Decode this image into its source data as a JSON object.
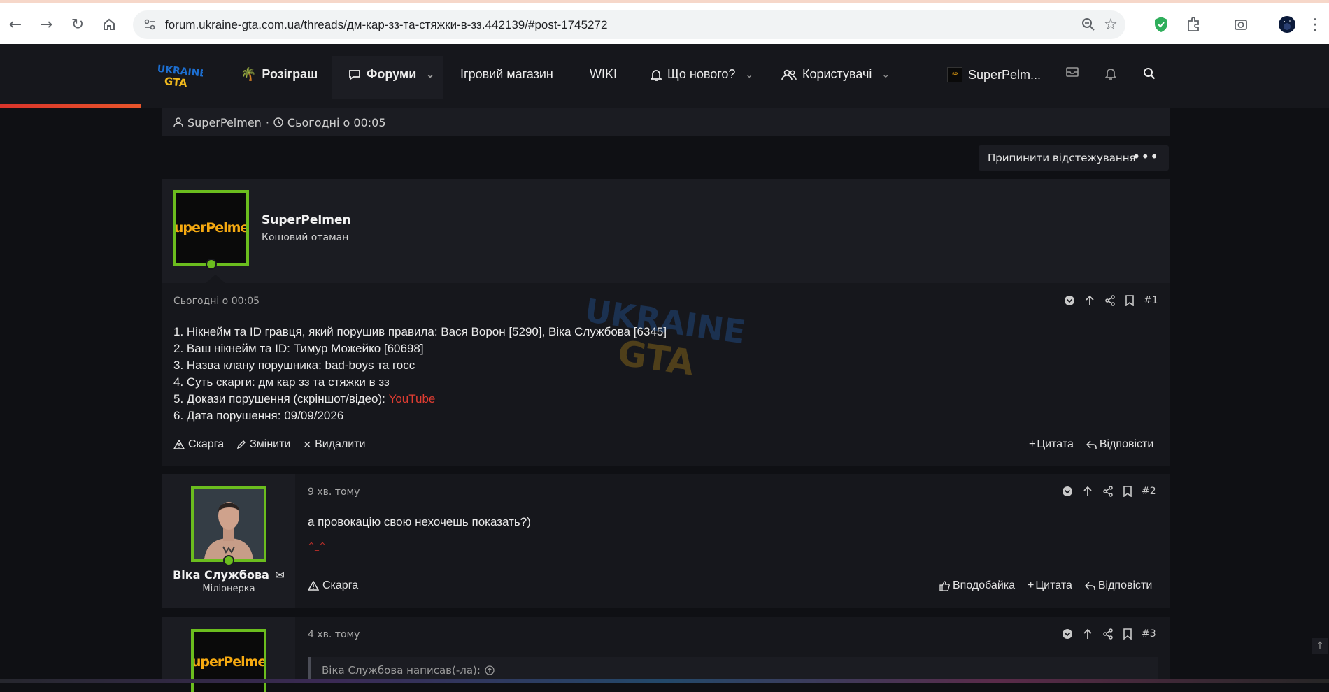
{
  "browser": {
    "url": "forum.ukraine-gta.com.ua/threads/дм-кар-зз-та-стяжки-в-зз.442139/#post-1745272"
  },
  "nav": {
    "giveaway": "Розіграш",
    "forums": "Форуми",
    "shop": "Ігровий магазин",
    "wiki": "WIKI",
    "whats_new": "Що нового?",
    "users": "Користувачі",
    "account": "SuperPelm..."
  },
  "thread_meta": {
    "author": "SuperPelmen",
    "separator": "·",
    "date": "Сьогодні о 00:05"
  },
  "watch_button": "Припинити відстежування",
  "posts": [
    {
      "author": "SuperPelmen",
      "title": "Кошовий отаман",
      "avatar_text": "SuperPelmen",
      "date": "Сьогодні о 00:05",
      "number": "#1",
      "lines": [
        "1. Нікнейм та ID гравця, який порушив правила: Вася Ворон [5290], Віка Службова [6345]",
        "2. Ваш нікнейм та ID: Тимур Можейко [60698]",
        "3. Назва клану порушника: bad-boys та госс",
        "4. Суть скарги: дм кар зз та стяжки в зз",
        "5. Докази порушення (скріншот/відео): ",
        "6. Дата порушення: 09/09/2026"
      ],
      "link_text": "YouTube",
      "actions": {
        "report": "Скарга",
        "edit": "Змінити",
        "delete": "Видалити",
        "quote": "Цитата",
        "reply": "Відповісти"
      }
    },
    {
      "author": "Віка Службова",
      "title": "Міліонерка",
      "date": "9 хв. тому",
      "number": "#2",
      "text": "а провокацію свою нехочешь показать?)",
      "signature": "^_^",
      "actions": {
        "report": "Скарга",
        "like": "Вподобайка",
        "quote": "Цитата",
        "reply": "Відповісти"
      }
    },
    {
      "avatar_text": "SuperPelmen",
      "date": "4 хв. тому",
      "number": "#3",
      "quote_header": "Віка Службова написав(-ла):"
    }
  ],
  "watermark": {
    "line1": "UKRAINE",
    "line2": "GTA"
  },
  "logo": {
    "line1": "UKRAINE",
    "line2": "GTA"
  },
  "colors": {
    "accent_green": "#6bbd1e",
    "link_red": "#e03d32",
    "bg": "#0f1014"
  }
}
